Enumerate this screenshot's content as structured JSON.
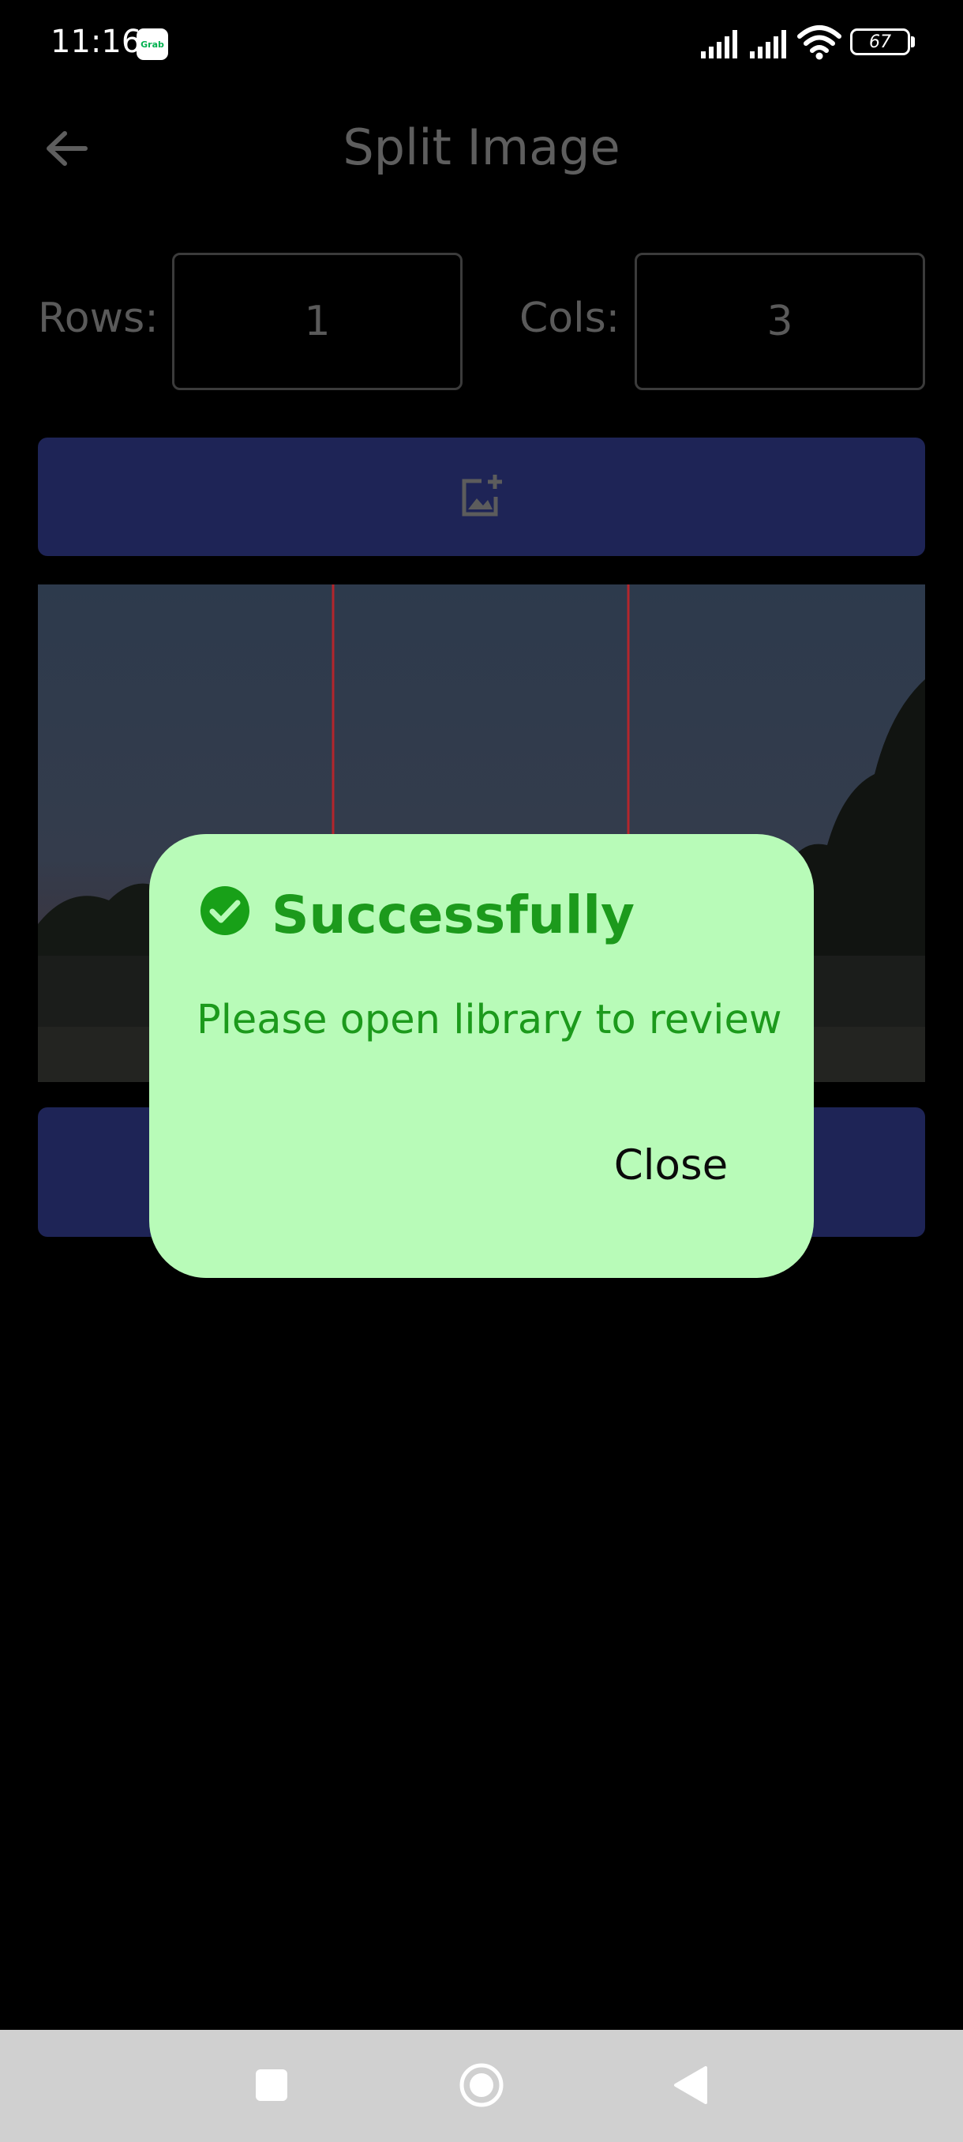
{
  "status_bar": {
    "time": "11:16",
    "app_badge": "Grab",
    "battery": "67"
  },
  "header": {
    "title": "Split Image",
    "back_icon": "arrow-left-icon"
  },
  "grid": {
    "rows_label": "Rows:",
    "rows_value": "1",
    "cols_label": "Cols:",
    "cols_value": "3"
  },
  "add_image_button": {
    "icon": "add-photo-icon"
  },
  "dialog": {
    "title": "Successfully",
    "message": "Please open library to review",
    "close_label": "Close",
    "icon": "check-circle-icon"
  },
  "navigation": {
    "recents_icon": "square-icon",
    "home_icon": "circle-icon",
    "back_icon": "triangle-back-icon"
  },
  "colors": {
    "background": "#000000",
    "button": "#1e2456",
    "dialog_bg": "#b8fbb8",
    "dialog_text": "#1c9a1c",
    "split_line": "#b3262c"
  }
}
